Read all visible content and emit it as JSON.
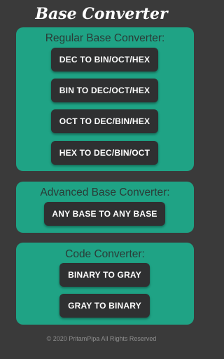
{
  "header": {
    "title": "Base Converter"
  },
  "regular": {
    "title": "Regular Base Converter:",
    "buttons": [
      "DEC TO BIN/OCT/HEX",
      "BIN TO DEC/OCT/HEX",
      "OCT TO DEC/BIN/HEX",
      "HEX TO DEC/BIN/OCT"
    ]
  },
  "advanced": {
    "title": "Advanced Base Converter:",
    "buttons": [
      "ANY BASE TO ANY BASE"
    ]
  },
  "code": {
    "title": "Code Converter:",
    "buttons": [
      "BINARY TO GRAY",
      "GRAY TO BINARY"
    ]
  },
  "footer": {
    "text": "© 2020 PritamPipa All Rights Reserved"
  },
  "colors": {
    "background": "#3a3a3a",
    "card": "#1fa385",
    "button": "#2f3031"
  }
}
